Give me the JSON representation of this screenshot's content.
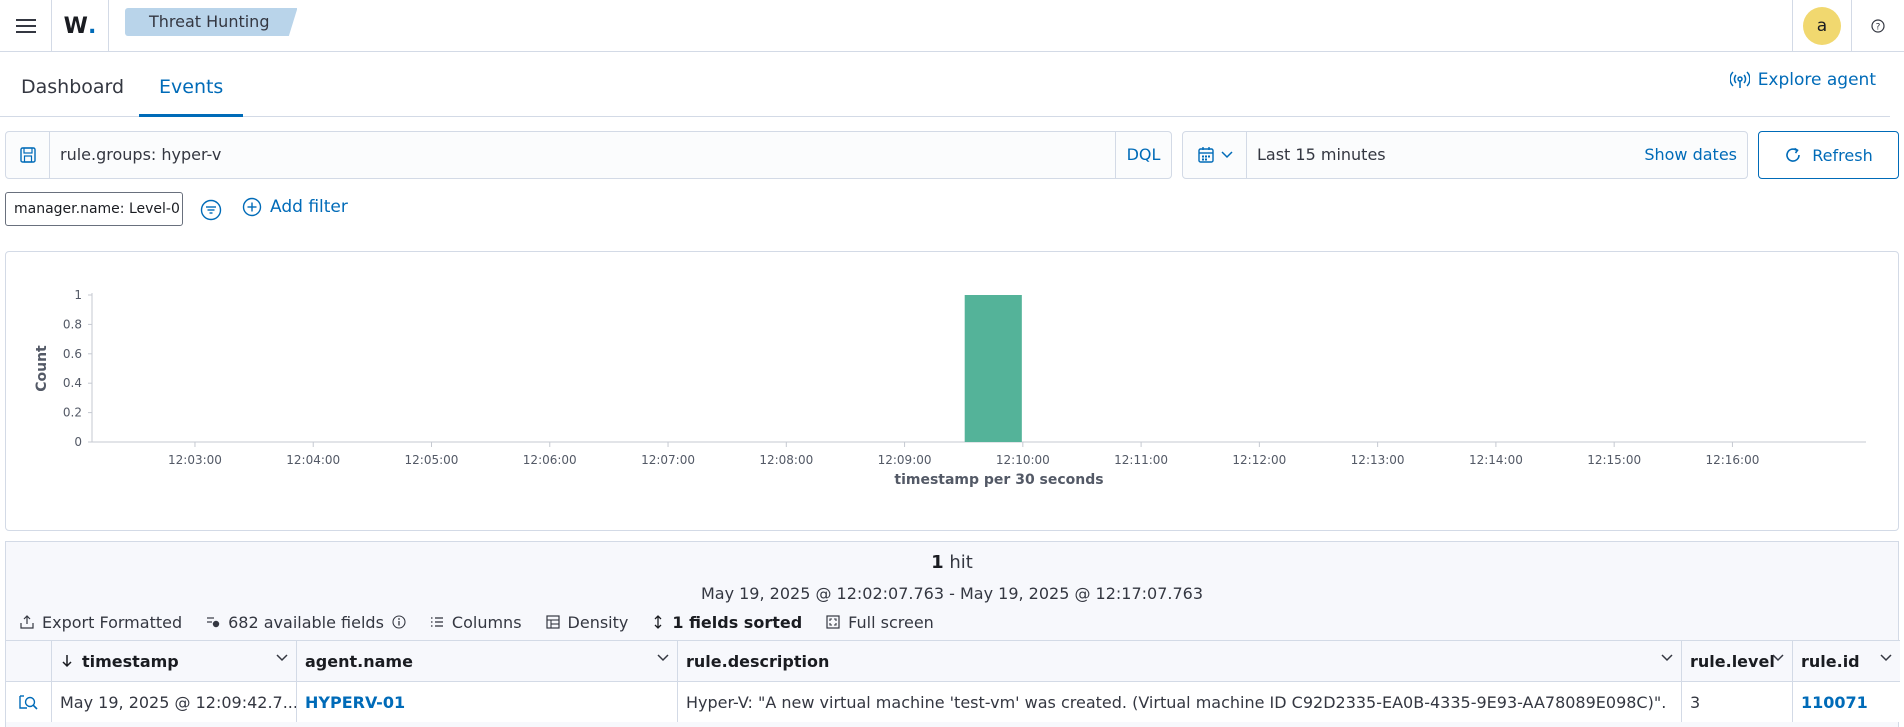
{
  "header": {
    "brand": "W",
    "brand_dot": ".",
    "breadcrumb": "Threat Hunting",
    "user_initial": "a"
  },
  "tabs": [
    {
      "label": "Dashboard",
      "active": false
    },
    {
      "label": "Events",
      "active": true
    }
  ],
  "explore_agent": "Explore agent",
  "query": {
    "text": "rule.groups: hyper-v",
    "language": "DQL"
  },
  "date": {
    "range": "Last 15 minutes",
    "show_dates": "Show dates",
    "refresh": "Refresh"
  },
  "filters": {
    "pill": "manager.name: Level-0",
    "add_filter": "Add filter"
  },
  "chart_data": {
    "type": "bar",
    "title": "",
    "xlabel": "timestamp per 30 seconds",
    "ylabel": "Count",
    "ylim": [
      0,
      1
    ],
    "yticks": [
      "0",
      "0.2",
      "0.4",
      "0.6",
      "0.8",
      "1"
    ],
    "xticks": [
      "12:03:00",
      "12:04:00",
      "12:05:00",
      "12:06:00",
      "12:07:00",
      "12:08:00",
      "12:09:00",
      "12:10:00",
      "12:11:00",
      "12:12:00",
      "12:13:00",
      "12:14:00",
      "12:15:00",
      "12:16:00"
    ],
    "x_range": [
      "12:02:07.763",
      "12:17:07.763"
    ],
    "categories": [
      "12:09:30"
    ],
    "values": [
      1
    ],
    "bar_color": "#54b399",
    "grid": false
  },
  "results": {
    "hits_count": "1",
    "hits_label": "hit",
    "time_range": "May 19, 2025 @ 12:02:07.763 - May 19, 2025 @ 12:17:07.763",
    "toolbar": {
      "export": "Export Formatted",
      "fields": "682 available fields",
      "columns": "Columns",
      "density": "Density",
      "sorted": "1 fields sorted",
      "fullscreen": "Full screen"
    },
    "columns": [
      "timestamp",
      "agent.name",
      "rule.description",
      "rule.level",
      "rule.id"
    ],
    "rows": [
      {
        "timestamp": "May 19, 2025 @ 12:09:42.7...",
        "agent_name": "HYPERV-01",
        "description": "Hyper-V: \"A new virtual machine 'test-vm' was created. (Virtual machine ID C92D2335-EA0B-4335-9E93-AA78089E098C)\".",
        "level": "3",
        "id": "110071"
      }
    ]
  },
  "colors": {
    "accent": "#006bb8",
    "breadcrumb_bg": "#b9d4ea",
    "avatar_bg": "#f1d86f",
    "bar": "#54b399"
  }
}
